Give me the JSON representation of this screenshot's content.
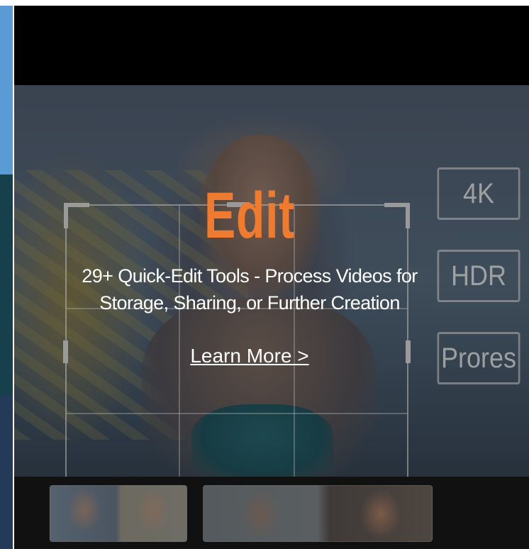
{
  "hero": {
    "headline": "Edit",
    "description": "29+ Quick-Edit Tools - Process Videos for Storage, Sharing, or Further Creation",
    "learn_more": "Learn More >",
    "headline_color": "#ee7b30"
  },
  "badges": [
    {
      "label": "4K"
    },
    {
      "label": "HDR"
    },
    {
      "label": "Prores"
    }
  ],
  "colors": {
    "left_strip_top": "#5b9bd5",
    "left_strip_mid": "#16404c",
    "left_strip_bottom": "#233a58",
    "background": "#000000"
  }
}
